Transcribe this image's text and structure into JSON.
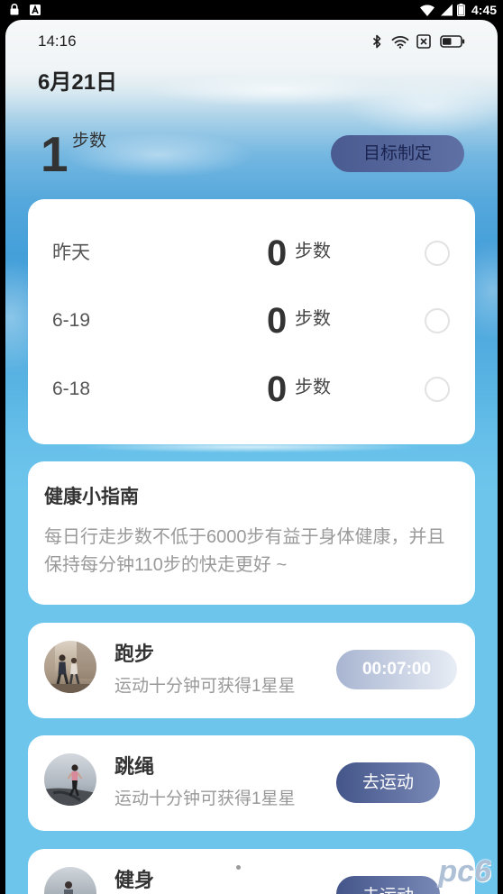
{
  "system_status_bar": {
    "left_icons": [
      "lock-icon",
      "app-notification-icon"
    ],
    "right_icons": [
      "wifi-icon",
      "signal-icon",
      "battery-icon"
    ],
    "battery_level": 1.0,
    "time": "4:45"
  },
  "app_status_bar": {
    "time": "14:16",
    "icons": [
      "bluetooth-icon",
      "wifi-icon",
      "close-box-icon",
      "battery-icon"
    ],
    "battery_level": 0.5
  },
  "header": {
    "date": "6月21日",
    "today_steps": "1",
    "steps_unit": "步数",
    "goal_button_label": "目标制定"
  },
  "history": [
    {
      "label": "昨天",
      "steps": "0",
      "unit": "步数"
    },
    {
      "label": "6-19",
      "steps": "0",
      "unit": "步数"
    },
    {
      "label": "6-18",
      "steps": "0",
      "unit": "步数"
    }
  ],
  "guide": {
    "title": "健康小指南",
    "body": "每日行走步数不低于6000步有益于身体健康，并且保持每分钟110步的快走更好 ~"
  },
  "activities": [
    {
      "name": "跑步",
      "desc": "运动十分钟可获得1星星",
      "button": "00:07:00"
    },
    {
      "name": "跳绳",
      "desc": "运动十分钟可获得1星星",
      "button": "去运动"
    },
    {
      "name": "健身",
      "button": "去运动"
    }
  ],
  "watermark": {
    "text": "pc6"
  },
  "theme": {
    "page_background": "#6dc5ec",
    "goal_button": "#5e70a4",
    "go_button_start": "#44558a",
    "go_button_end": "#7989b6",
    "timer_button_start": "#a8b5d1",
    "timer_button_end": "#e8edf5"
  }
}
